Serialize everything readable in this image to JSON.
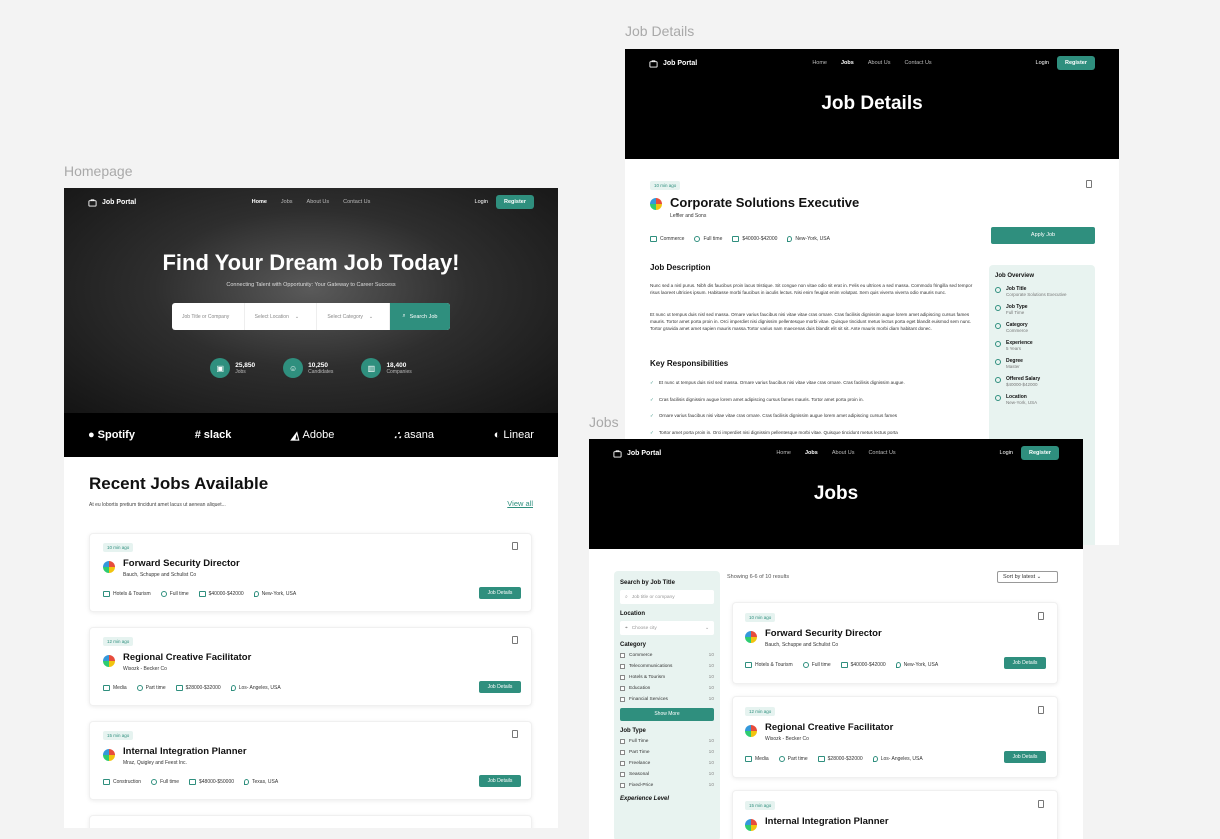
{
  "labels": {
    "homepage": "Homepage",
    "details": "Job Details",
    "jobs": "Jobs"
  },
  "nav": {
    "logo": "Job Portal",
    "home": "Home",
    "jobs": "Jobs",
    "about": "About Us",
    "contact": "Contact Us",
    "login": "Login",
    "register": "Register"
  },
  "home": {
    "title": "Find Your Dream Job Today!",
    "subtitle": "Connecting Talent with Opportunity: Your Gateway to Career Success",
    "search": {
      "title_placeholder": "Job Title or Company",
      "location": "Select Location",
      "category": "Select Category",
      "button": "Search Job"
    },
    "stats": [
      {
        "num": "25,850",
        "lbl": "Jobs"
      },
      {
        "num": "10,250",
        "lbl": "Candidates"
      },
      {
        "num": "18,400",
        "lbl": "Companies"
      }
    ],
    "brands": [
      "Spotify",
      "slack",
      "Adobe",
      "asana",
      "Linear"
    ],
    "recent_title": "Recent Jobs Available",
    "recent_sub": "At eu lobortis pretium tincidunt amet lacus ut aenean aliquet...",
    "view_all": "View all",
    "jobs": [
      {
        "time": "10 min ago",
        "title": "Forward Security Director",
        "company": "Bauch, Schuppe and Schulist Co",
        "cat": "Hotels & Tourism",
        "type": "Full time",
        "salary": "$40000-$42000",
        "loc": "New-York, USA",
        "btn": "Job Details"
      },
      {
        "time": "12 min ago",
        "title": "Regional Creative Facilitator",
        "company": "Wisozk - Becker Co",
        "cat": "Media",
        "type": "Part time",
        "salary": "$28000-$32000",
        "loc": "Los- Angeles, USA",
        "btn": "Job Details"
      },
      {
        "time": "15 min ago",
        "title": "Internal Integration Planner",
        "company": "Mraz, Quigley and Feest Inc.",
        "cat": "Construction",
        "type": "Full time",
        "salary": "$48000-$50000",
        "loc": "Texas, USA",
        "btn": "Job Details"
      }
    ]
  },
  "details": {
    "title": "Job Details",
    "time": "10 min ago",
    "job_title": "Corporate Solutions Executive",
    "company": "Leffler and Sons",
    "cat": "Commerce",
    "type": "Full time",
    "salary": "$40000-$42000",
    "loc": "New-York, USA",
    "apply": "Apply Job",
    "desc_title": "Job Description",
    "desc1": "Nunc sed a nisl purus. Nibh dis faucibus proin lacus tristique. Sit congue non vitae odio sit erat in. Felis eu ultrices a sed massa. Commodo fringilla sed tempor risus laoreet ultricies ipsum. Habitasse morbi faucibus in iaculis lectus. Nisi enim feugiat enim volutpat. Sem quis viverra viverra odio mauris nunc.",
    "desc2": "Et nunc ut tempus duis nisl sed massa. Ornare varius faucibus nisi vitae vitae cras ornare. Cras facilisis dignissim augue lorem amet adipiscing cursus fames mauris. Tortor amet porta proin in. Orci imperdiet nisi dignissim pellentesque morbi vitae. Quisque tincidunt metus lectus porta eget blandit euismod sem nunc. Tortor gravida amet amet sapien mauris massa.Tortor varius nam maecenas duis blandit elit sit sit. Ante mauris morbi diam habitant donec.",
    "resp_title": "Key Responsibilities",
    "resp": [
      "Et nunc ut tempus duis nisl sed massa. Ornare varius faucibus nisi vitae vitae cras ornare. Cras facilisis dignissim augue.",
      "Cras facilisis dignissim augue lorem amet adipiscing cursus fames mauris. Tortor amet porta proin in.",
      "Ornare varius faucibus nisi vitae vitae cras ornare. Cras facilisis dignissim augue lorem amet adipiscing cursus fames",
      "Tortor amet porta proin in. Orci imperdiet nisi dignissim pellentesque morbi vitae. Quisque tincidunt metus lectus porta"
    ],
    "overview_title": "Job Overview",
    "overview": [
      {
        "k": "Job Title",
        "v": "Corporate Solutions Executive"
      },
      {
        "k": "Job Type",
        "v": "Full Time"
      },
      {
        "k": "Category",
        "v": "Commerce"
      },
      {
        "k": "Experience",
        "v": "5 Years"
      },
      {
        "k": "Degree",
        "v": "Master"
      },
      {
        "k": "Offered Salary",
        "v": "$40000-$42000"
      },
      {
        "k": "Location",
        "v": "New-York, USA"
      }
    ]
  },
  "jobs_page": {
    "title": "Jobs",
    "showing": "Showing 6-6 of 10 results",
    "sort": "Sort by latest",
    "f_search": "Search by Job Title",
    "f_search_ph": "Job title or company",
    "f_location": "Location",
    "f_location_ph": "Choose city",
    "f_category": "Category",
    "categories": [
      {
        "n": "Commerce",
        "c": "10"
      },
      {
        "n": "Telecommunications",
        "c": "10"
      },
      {
        "n": "Hotels & Tourism",
        "c": "10"
      },
      {
        "n": "Education",
        "c": "10"
      },
      {
        "n": "Financial Services",
        "c": "10"
      }
    ],
    "show_more": "Show More",
    "f_type": "Job Type",
    "types": [
      {
        "n": "Full Time",
        "c": "10"
      },
      {
        "n": "Part Time",
        "c": "10"
      },
      {
        "n": "Freelance",
        "c": "10"
      },
      {
        "n": "Seasonal",
        "c": "10"
      },
      {
        "n": "Fixed-Price",
        "c": "10"
      }
    ],
    "f_exp": "Experience Level",
    "list": [
      {
        "time": "10 min ago",
        "title": "Forward Security Director",
        "company": "Bauch, Schuppe and Schulist Co",
        "cat": "Hotels & Tourism",
        "type": "Full time",
        "salary": "$40000-$42000",
        "loc": "New-York, USA",
        "btn": "Job Details"
      },
      {
        "time": "12 min ago",
        "title": "Regional Creative Facilitator",
        "company": "Wisozk - Becker Co",
        "cat": "Media",
        "type": "Part time",
        "salary": "$28000-$32000",
        "loc": "Los- Angeles, USA",
        "btn": "Job Details"
      },
      {
        "time": "15 min ago",
        "title": "Internal Integration Planner"
      }
    ]
  }
}
